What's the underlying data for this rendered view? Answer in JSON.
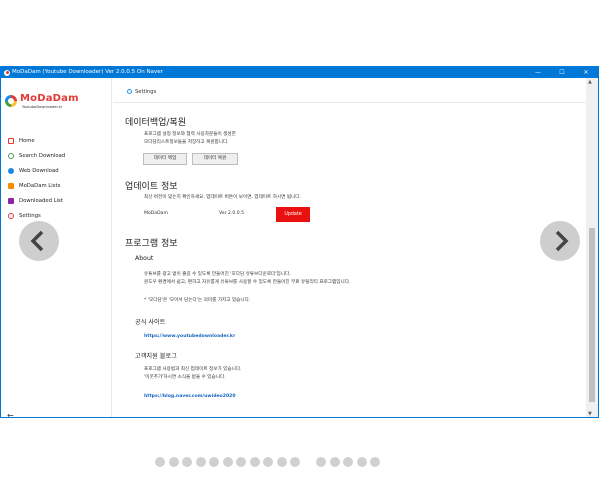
{
  "window": {
    "title": "MoDaDam (Youtube Downloader) Ver 2.0.0.5 On Naver",
    "controls": [
      "—",
      "☐",
      "✕"
    ]
  },
  "sidebar": {
    "logo_text": "MoDaDam",
    "logo_sub": "YoutubeDownloader.kr",
    "items": [
      {
        "label": "Home",
        "icon": "home-icon",
        "color": "#e53935"
      },
      {
        "label": "Search Download",
        "icon": "search-icon",
        "color": "#43a047"
      },
      {
        "label": "Web Download",
        "icon": "globe-icon",
        "color": "#1e88e5"
      },
      {
        "label": "MoDaDam Lists",
        "icon": "list-icon",
        "color": "#fb8c00"
      },
      {
        "label": "Downloaded List",
        "icon": "download-list-icon",
        "color": "#8e24aa"
      },
      {
        "label": "Settings",
        "icon": "gear-icon",
        "color": "#e53935"
      }
    ],
    "back": "←"
  },
  "main": {
    "breadcrumb": "Settings",
    "backup": {
      "title": "데이터백업/복원",
      "desc1": "프로그램 설정 정보와 협력 사용자분들이 생성한",
      "desc2": "모다담리스트정보들을 저장하고 복원합니다.",
      "backup_button": "데이터 백업",
      "restore_button": "데이터 복원"
    },
    "update": {
      "title": "업데이트 정보",
      "desc": "최신 버전이 맞는지 확인하세요. 업데이트 버튼이 보이면, 업데이트 하시면 됩니다.",
      "app_name": "MoDaDam",
      "version": "Ver 2.0.0.5",
      "update_button": "Update"
    },
    "program": {
      "title": "프로그램 정보",
      "about_title": "About",
      "about1": "유튜브를 광고 없이 즐길 수 있도록 만들어진 '모다담 유튜브다운로더'입니다.",
      "about2": "윈도우 환경에서 쉽고, 편하고 자유롭게 유튜브를 사용할 수 있도록 만들어진 무료 유틸리티 프로그램입니다.",
      "note": "* '모다담'은 '모아서 담는다'는 의미를 가지고 있습니다.",
      "site_title": "공식 사이트",
      "site_url": "https://www.youtubedownloader.kr",
      "support_title": "고객지원 블로그",
      "support1": "프로그램 사용법과 최신 업데이트 정보가 있습니다.",
      "support2": "'이웃추가'하시면 소식을 받을 수 있습니다.",
      "blog_url": "https://blog.naver.com/uwideo2020"
    }
  },
  "carousel": {
    "prev": "‹",
    "next": "›",
    "dots_group1": 11,
    "dots_group2": 5
  }
}
